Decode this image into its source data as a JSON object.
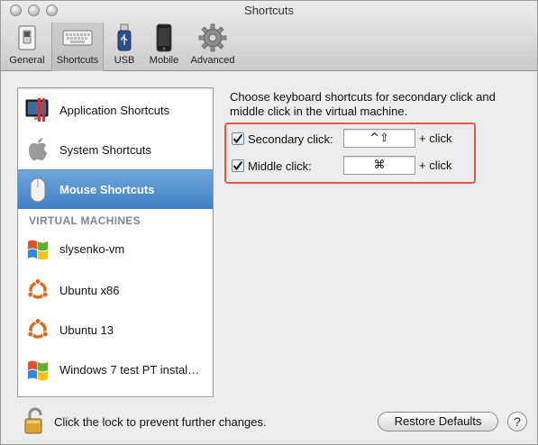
{
  "window": {
    "title": "Shortcuts"
  },
  "toolbar": {
    "items": [
      {
        "label": "General",
        "icon": "switch-icon"
      },
      {
        "label": "Shortcuts",
        "icon": "keyboard-icon",
        "selected": true
      },
      {
        "label": "USB",
        "icon": "usb-icon"
      },
      {
        "label": "Mobile",
        "icon": "iphone-icon"
      },
      {
        "label": "Advanced",
        "icon": "gear-icon"
      }
    ]
  },
  "sidebar": {
    "items": [
      {
        "label": "Application Shortcuts",
        "icon": "app-shortcuts-icon"
      },
      {
        "label": "System Shortcuts",
        "icon": "apple-icon"
      },
      {
        "label": "Mouse Shortcuts",
        "icon": "mouse-icon",
        "selected": true
      }
    ],
    "section_header": "VIRTUAL MACHINES",
    "vms": [
      {
        "label": "slysenko-vm",
        "icon": "windows-icon"
      },
      {
        "label": "Ubuntu x86",
        "icon": "ubuntu-icon"
      },
      {
        "label": "Ubuntu 13",
        "icon": "ubuntu-icon"
      },
      {
        "label": "Windows 7 test PT instal…",
        "icon": "windows-icon"
      }
    ]
  },
  "panel": {
    "description": "Choose keyboard shortcuts for secondary click and middle click in the virtual machine.",
    "options": [
      {
        "label": "Secondary click:",
        "checked": true,
        "shortcut": "^⇧",
        "suffix": "+ click"
      },
      {
        "label": "Middle click:",
        "checked": true,
        "shortcut": "⌘",
        "suffix": "+ click"
      }
    ]
  },
  "footer": {
    "lock_text": "Click the lock to prevent further changes.",
    "restore_button": "Restore Defaults",
    "help_button": "?"
  },
  "colors": {
    "selection": "#3d7fc6",
    "highlight_border": "#e4574b",
    "section_header": "#7b8794"
  }
}
